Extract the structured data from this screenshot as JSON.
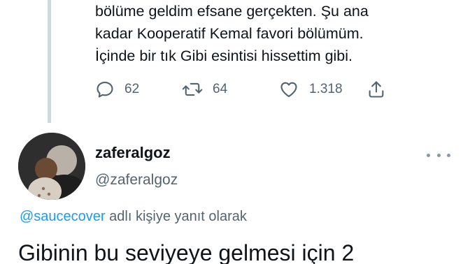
{
  "previous_tweet": {
    "text": "bölüme geldim efsane gerçekten. Şu ana\nkadar Kooperatif Kemal favori bölümüm.\nİçinde bir tık Gibi esintisi hissettim gibi.",
    "actions": {
      "reply_count": "62",
      "retweet_count": "64",
      "like_count": "1.318"
    },
    "icons": [
      "reply-icon",
      "retweet-icon",
      "like-icon",
      "share-icon"
    ]
  },
  "tweet": {
    "display_name": "zaferalgoz",
    "handle": "@zaferalgoz",
    "reply_mention": "@saucecover",
    "reply_suffix": " adlı kişiye yanıt olarak",
    "text": "Gibinin bu seviyeye gelmesi için 2"
  },
  "colors": {
    "text": "#0f1419",
    "secondary": "#536471",
    "link": "#1d9bf0",
    "thread_line": "#cfd9de"
  }
}
